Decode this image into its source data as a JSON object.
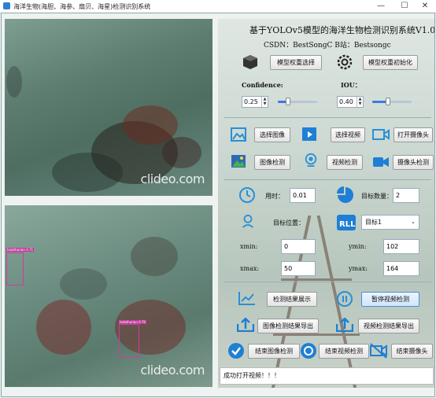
{
  "window": {
    "title": "海洋生物(海胆、海参、扇贝、海星)检测识别系统",
    "controls": {
      "minimize": "—",
      "maximize": "☐",
      "close": "✕"
    }
  },
  "images": {
    "watermark_top": "clideo.com",
    "watermark_bottom": "clideo.com",
    "detections": [
      "holothurian 0.71",
      "holothurian 0.70"
    ]
  },
  "header": {
    "title": "基于YOLOv5模型的海洋生物检测识别系统V1.0",
    "credits": "CSDN：BestSongC   B站：Bestsongc"
  },
  "model": {
    "select_weights_btn": "模型权重选择",
    "init_weights_btn": "模型权重初始化",
    "confidence_label": "Confidence:",
    "confidence_value": "0.25",
    "confidence_level": 0.25,
    "iou_label": "IOU：",
    "iou_value": "0.40",
    "iou_level": 0.4
  },
  "sources": {
    "select_image_btn": "选择图像",
    "select_video_btn": "选择视频",
    "open_camera_btn": "打开摄像头",
    "image_detect_btn": "图像检测",
    "video_detect_btn": "视频检测",
    "camera_detect_btn": "摄像头检测"
  },
  "results": {
    "time_label": "用时：",
    "time_value": "0.01",
    "count_label": "目标数量：",
    "count_value": "2",
    "position_label": "目标位置：",
    "target_select": "目标1",
    "xmin_label": "xmin:",
    "xmin_value": "0",
    "ymin_label": "ymin:",
    "ymin_value": "102",
    "xmax_label": "xmax:",
    "xmax_value": "50",
    "ymax_label": "ymax:",
    "ymax_value": "164"
  },
  "actions": {
    "show_results_btn": "检测结果展示",
    "pause_video_btn": "暂停视频检测",
    "export_image_btn": "图像检测结果导出",
    "export_video_btn": "视频检测结果导出",
    "end_image_btn": "结束图像检测",
    "end_video_btn": "结束视频检测",
    "end_camera_btn": "结束摄像头"
  },
  "status": {
    "message": "成功打开视频！！！"
  },
  "colors": {
    "accent": "#2a8fd6",
    "detection_box": "#d03aa0"
  }
}
